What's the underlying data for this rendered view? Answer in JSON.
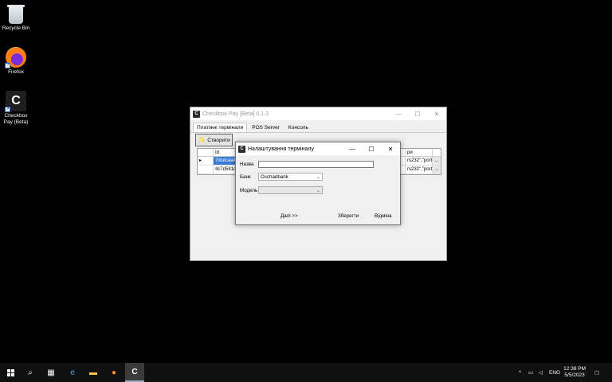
{
  "desktop": {
    "icons": [
      {
        "label": "Recycle Bin"
      },
      {
        "label": "Firefox"
      },
      {
        "label": "Checkbox Pay (Beta)"
      }
    ]
  },
  "main_window": {
    "title": "Checkbox Pay [Beta] 0.1.3",
    "tabs": [
      "Платіжні термінали",
      "POS Server",
      "Консоль"
    ],
    "create_button": "Створити",
    "grid": {
      "headers": [
        "Id",
        "ри"
      ],
      "rows": [
        {
          "id": "7dcecaa4",
          "params": "rs232\",\"port...",
          "btn": "..."
        },
        {
          "id": "4c7d581d",
          "params": "rs232\",\"port...",
          "btn": "..."
        }
      ]
    }
  },
  "dialog": {
    "title": "Налаштування терміналу",
    "name_label": "Назва",
    "name_value": "",
    "bank_label": "Банк",
    "bank_value": "Oschadbank",
    "model_label": "Модель",
    "model_value": "",
    "next_button": "Далі >>",
    "save_button": "Зберегти",
    "cancel_button": "Відміна"
  },
  "taskbar": {
    "language": "ENG",
    "time": "12:38 PM",
    "date": "5/5/2023"
  }
}
